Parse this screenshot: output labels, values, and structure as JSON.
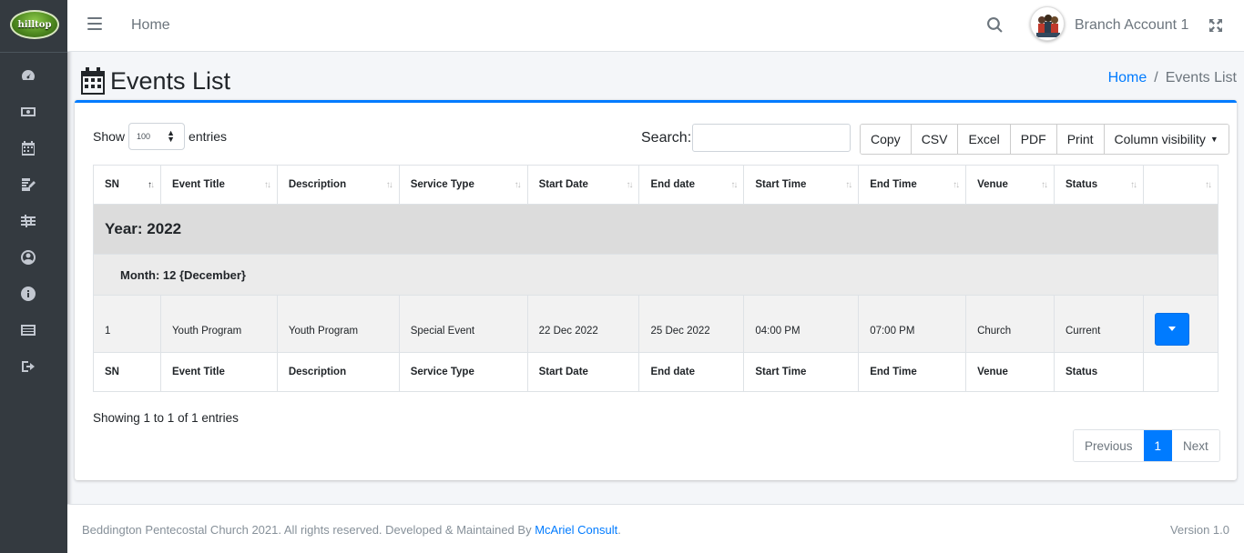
{
  "brand": {
    "logo_text": "hilltop"
  },
  "sidebar": {
    "items": [
      {
        "icon": "dashboard-icon"
      },
      {
        "icon": "money-icon"
      },
      {
        "icon": "calendar-icon"
      },
      {
        "icon": "edit-icon"
      },
      {
        "icon": "sliders-icon"
      },
      {
        "icon": "user-circle-icon"
      },
      {
        "icon": "info-icon"
      },
      {
        "icon": "list-icon"
      },
      {
        "icon": "sign-out-icon"
      }
    ]
  },
  "topbar": {
    "home_label": "Home",
    "account_name": "Branch Account 1"
  },
  "page": {
    "title": "Events List",
    "breadcrumb": {
      "home": "Home",
      "separator": "/",
      "current": "Events List"
    }
  },
  "table_controls": {
    "show_label": "Show",
    "entries_value": "100",
    "entries_label": "entries",
    "search_label": "Search:",
    "search_value": "",
    "buttons": {
      "copy": "Copy",
      "csv": "CSV",
      "excel": "Excel",
      "pdf": "PDF",
      "print": "Print",
      "column_visibility": "Column visibility"
    }
  },
  "table": {
    "columns": [
      "SN",
      "Event Title",
      "Description",
      "Service Type",
      "Start Date",
      "End date",
      "Start Time",
      "End Time",
      "Venue",
      "Status"
    ],
    "group_year": "Year: 2022",
    "group_month": "Month: 12 {December}",
    "rows": [
      {
        "sn": "1",
        "event_title": "Youth Program",
        "description": "Youth Program",
        "service_type": "Special Event",
        "start_date": "22 Dec 2022",
        "end_date": "25 Dec 2022",
        "start_time": "04:00 PM",
        "end_time": "07:00 PM",
        "venue": "Church",
        "status": "Current"
      }
    ]
  },
  "table_info": "Showing 1 to 1 of 1 entries",
  "pagination": {
    "previous": "Previous",
    "current": "1",
    "next": "Next"
  },
  "footer": {
    "copyright": "Beddington Pentecostal Church 2021. All rights reserved. Developed & Maintained By ",
    "developer_link": "McAriel Consult",
    "period": ".",
    "version": "Version 1.0"
  },
  "colors": {
    "accent": "#007bff",
    "sidebar": "#343a40"
  }
}
